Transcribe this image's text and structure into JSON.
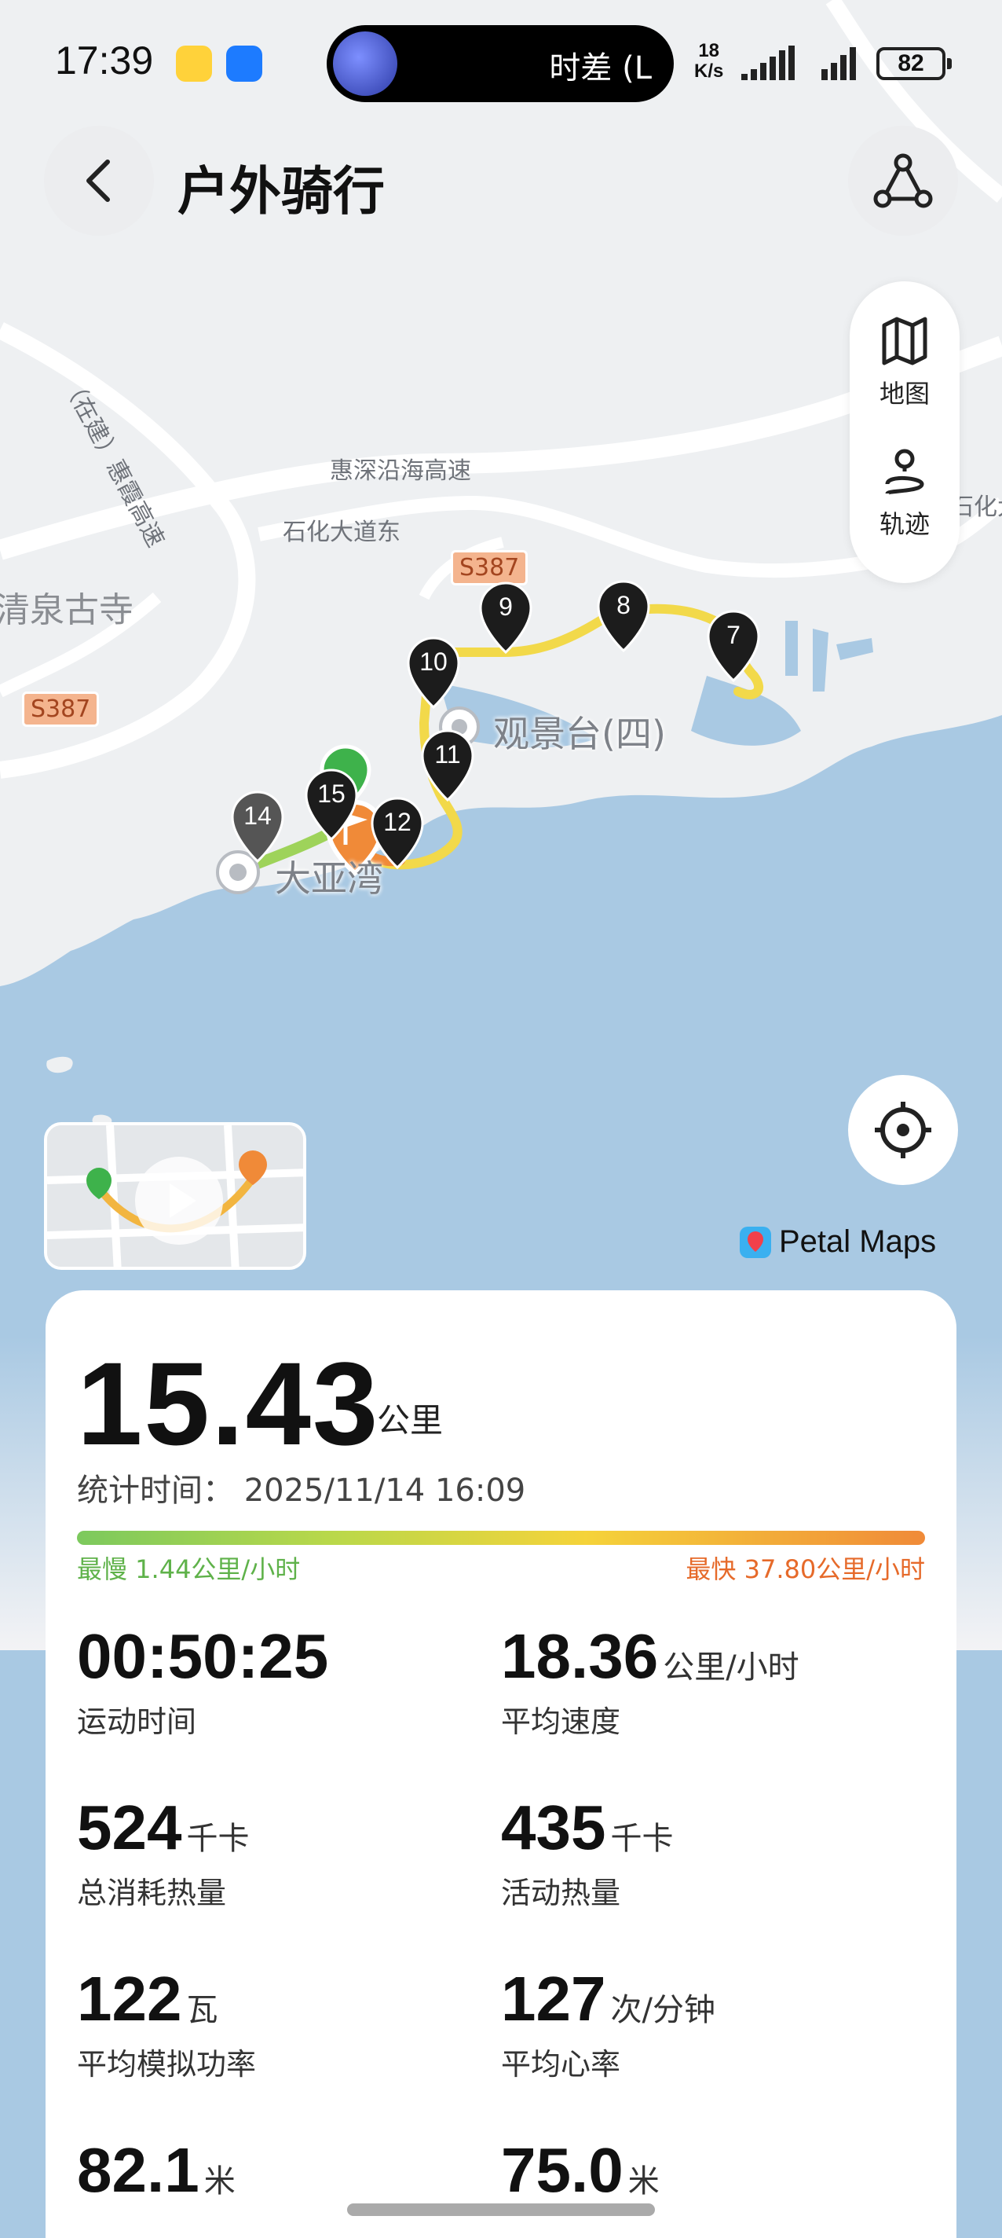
{
  "status_bar": {
    "time": "17:39",
    "island_text": "时差 (L",
    "net_speed_value": "18",
    "net_speed_unit": "K/s",
    "battery": "82"
  },
  "header": {
    "title": "户外骑行",
    "back_icon": "chevron-left-icon",
    "route_icon": "route-share-icon"
  },
  "map": {
    "labels": {
      "highway": "惠深沿海高速",
      "avenue": "石化大道东",
      "avenue_right": "石化大道",
      "vertical_road": "（在建）惠霞高速",
      "temple": "清泉古寺",
      "viewpoint": "观景台(四)",
      "dayawan": "大亚湾",
      "shield_s387_a": "S387",
      "shield_s387_b": "S387"
    },
    "markers": [
      "9",
      "8",
      "7",
      "10",
      "11",
      "14",
      "15",
      "12"
    ],
    "mode_panel": {
      "map_label": "地图",
      "track_label": "轨迹"
    },
    "attribution": "Petal Maps"
  },
  "summary": {
    "distance": "15.43",
    "distance_unit": "公里",
    "stat_time": "统计时间：  2025/11/14 16:09",
    "speed_min": "最慢 1.44公里/小时",
    "speed_max": "最快 37.80公里/小时"
  },
  "metrics": [
    {
      "value": "00:50:25",
      "unit": "",
      "label": "运动时间"
    },
    {
      "value": "18.36",
      "unit": "公里/小时",
      "label": "平均速度"
    },
    {
      "value": "524",
      "unit": "千卡",
      "label": "总消耗热量"
    },
    {
      "value": "435",
      "unit": "千卡",
      "label": "活动热量"
    },
    {
      "value": "122",
      "unit": "瓦",
      "label": "平均模拟功率"
    },
    {
      "value": "127",
      "unit": "次/分钟",
      "label": "平均心率"
    },
    {
      "value": "82.1",
      "unit": "米",
      "label": ""
    },
    {
      "value": "75.0",
      "unit": "米",
      "label": ""
    }
  ],
  "colors": {
    "track_yellow": "#f2d94a",
    "track_green": "#9ed35a",
    "track_orange": "#f08a38",
    "sea": "#a9c9e3",
    "land": "#eef0f2"
  }
}
